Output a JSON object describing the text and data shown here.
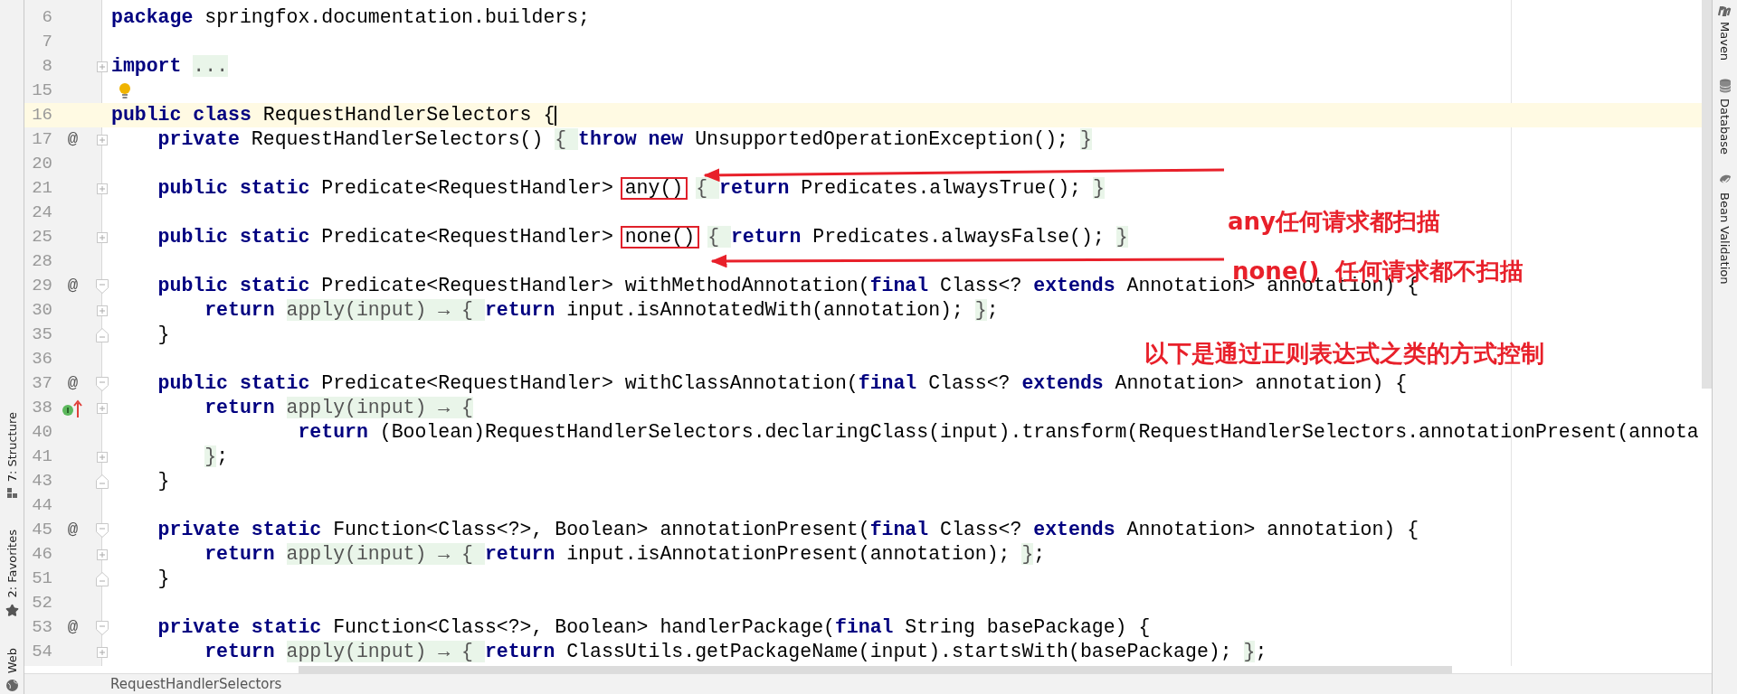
{
  "left_toolbar": [
    {
      "label": "7: Structure"
    },
    {
      "label": "2: Favorites"
    },
    {
      "label": "Web"
    }
  ],
  "right_toolbar": [
    {
      "label": "Maven"
    },
    {
      "label": "Database"
    },
    {
      "label": "Bean Validation"
    }
  ],
  "editor": {
    "lines": [
      {
        "number": "6",
        "segments": [
          {
            "kind": "kw",
            "text": "package"
          },
          {
            "kind": "txt",
            "text": " springfox.documentation.builders;"
          }
        ]
      },
      {
        "number": "7"
      },
      {
        "number": "8",
        "fold": {
          "kind": "expand"
        },
        "segments": [
          {
            "kind": "kw",
            "text": "import "
          },
          {
            "kind": "fold",
            "text": "..."
          }
        ]
      },
      {
        "number": "15",
        "bulb": true
      },
      {
        "number": "16",
        "current": true,
        "segments": [
          {
            "kind": "kw",
            "text": "public class"
          },
          {
            "kind": "txt",
            "text": " RequestHandlerSelectors {"
          }
        ]
      },
      {
        "number": "17",
        "marker": {
          "kind": "glyph",
          "text": "@"
        },
        "fold": {
          "kind": "expand"
        },
        "segments": [
          {
            "kind": "kw",
            "text": "    private"
          },
          {
            "kind": "txt",
            "text": " RequestHandlerSelectors() "
          },
          {
            "kind": "fold",
            "text": "{ "
          },
          {
            "kind": "kw",
            "text": "throw new"
          },
          {
            "kind": "txt",
            "text": " UnsupportedOperationException(); "
          },
          {
            "kind": "fold",
            "text": "}"
          }
        ]
      },
      {
        "number": "20"
      },
      {
        "number": "21",
        "fold": {
          "kind": "expand"
        },
        "segments": [
          {
            "kind": "kw",
            "text": "    public static"
          },
          {
            "kind": "txt",
            "text": " Predicate<RequestHandler> "
          },
          {
            "kind": "box",
            "text": "any()"
          },
          {
            "kind": "fold",
            "text": "{ "
          },
          {
            "kind": "kw",
            "text": "return"
          },
          {
            "kind": "txt",
            "text": " Predicates.alwaysTrue(); "
          },
          {
            "kind": "fold",
            "text": "}"
          }
        ]
      },
      {
        "number": "24"
      },
      {
        "number": "25",
        "fold": {
          "kind": "expand"
        },
        "segments": [
          {
            "kind": "kw",
            "text": "    public static"
          },
          {
            "kind": "txt",
            "text": " Predicate<RequestHandler> "
          },
          {
            "kind": "box",
            "text": "none()"
          },
          {
            "kind": "fold",
            "text": "{ "
          },
          {
            "kind": "kw",
            "text": "return"
          },
          {
            "kind": "txt",
            "text": " Predicates.alwaysFalse(); "
          },
          {
            "kind": "fold",
            "text": "}"
          }
        ]
      },
      {
        "number": "28"
      },
      {
        "number": "29",
        "marker": {
          "kind": "glyph",
          "text": "@"
        },
        "fold": {
          "kind": "start"
        },
        "segments": [
          {
            "kind": "kw",
            "text": "    public static"
          },
          {
            "kind": "txt",
            "text": " Predicate<RequestHandler> withMethodAnnotation("
          },
          {
            "kind": "kw",
            "text": "final"
          },
          {
            "kind": "txt",
            "text": " Class<? "
          },
          {
            "kind": "kw",
            "text": "extends"
          },
          {
            "kind": "txt",
            "text": " Annotation> annotation) {"
          }
        ]
      },
      {
        "number": "30",
        "fold": {
          "kind": "expand"
        },
        "segments": [
          {
            "kind": "kw",
            "text": "        return "
          },
          {
            "kind": "fold",
            "text": "apply(input) → { "
          },
          {
            "kind": "kw",
            "text": "return"
          },
          {
            "kind": "txt",
            "text": " input.isAnnotatedWith(annotation); "
          },
          {
            "kind": "fold",
            "text": "}"
          },
          {
            "kind": "txt",
            "text": ";"
          }
        ]
      },
      {
        "number": "35",
        "fold": {
          "kind": "end"
        },
        "segments": [
          {
            "kind": "txt",
            "text": "    }"
          }
        ]
      },
      {
        "number": "36"
      },
      {
        "number": "37",
        "marker": {
          "kind": "glyph",
          "text": "@"
        },
        "fold": {
          "kind": "start"
        },
        "segments": [
          {
            "kind": "kw",
            "text": "    public static"
          },
          {
            "kind": "txt",
            "text": " Predicate<RequestHandler> withClassAnnotation("
          },
          {
            "kind": "kw",
            "text": "final"
          },
          {
            "kind": "txt",
            "text": " Class<? "
          },
          {
            "kind": "kw",
            "text": "extends"
          },
          {
            "kind": "txt",
            "text": " Annotation> annotation) {"
          }
        ]
      },
      {
        "number": "38",
        "marker": {
          "kind": "implementation"
        },
        "fold": {
          "kind": "expand"
        },
        "segments": [
          {
            "kind": "kw",
            "text": "        return "
          },
          {
            "kind": "fold",
            "text": "apply(input) → {"
          }
        ]
      },
      {
        "number": "40",
        "segments": [
          {
            "kind": "kw",
            "text": "                return"
          },
          {
            "kind": "txt",
            "text": " (Boolean)RequestHandlerSelectors.declaringClass(input).transform(RequestHandlerSelectors.annotationPresent(annota"
          }
        ]
      },
      {
        "number": "41",
        "fold": {
          "kind": "expand"
        },
        "segments": [
          {
            "kind": "fold",
            "text": "        }"
          },
          {
            "kind": "txt",
            "text": ";"
          }
        ]
      },
      {
        "number": "43",
        "fold": {
          "kind": "end"
        },
        "segments": [
          {
            "kind": "txt",
            "text": "    }"
          }
        ]
      },
      {
        "number": "44"
      },
      {
        "number": "45",
        "marker": {
          "kind": "glyph",
          "text": "@"
        },
        "fold": {
          "kind": "start"
        },
        "segments": [
          {
            "kind": "kw",
            "text": "    private static"
          },
          {
            "kind": "txt",
            "text": " Function<Class<?>, Boolean> annotationPresent("
          },
          {
            "kind": "kw",
            "text": "final"
          },
          {
            "kind": "txt",
            "text": " Class<? "
          },
          {
            "kind": "kw",
            "text": "extends"
          },
          {
            "kind": "txt",
            "text": " Annotation> annotation) {"
          }
        ]
      },
      {
        "number": "46",
        "fold": {
          "kind": "expand"
        },
        "segments": [
          {
            "kind": "kw",
            "text": "        return "
          },
          {
            "kind": "fold",
            "text": "apply(input) → { "
          },
          {
            "kind": "kw",
            "text": "return"
          },
          {
            "kind": "txt",
            "text": " input.isAnnotationPresent(annotation); "
          },
          {
            "kind": "fold",
            "text": "}"
          },
          {
            "kind": "txt",
            "text": ";"
          }
        ]
      },
      {
        "number": "51",
        "fold": {
          "kind": "end"
        },
        "segments": [
          {
            "kind": "txt",
            "text": "    }"
          }
        ]
      },
      {
        "number": "52"
      },
      {
        "number": "53",
        "marker": {
          "kind": "glyph",
          "text": "@"
        },
        "fold": {
          "kind": "start"
        },
        "segments": [
          {
            "kind": "kw",
            "text": "    private static"
          },
          {
            "kind": "txt",
            "text": " Function<Class<?>, Boolean> handlerPackage("
          },
          {
            "kind": "kw",
            "text": "final"
          },
          {
            "kind": "txt",
            "text": " String basePackage) {"
          }
        ]
      },
      {
        "number": "54",
        "fold": {
          "kind": "expand"
        },
        "segments": [
          {
            "kind": "kw",
            "text": "        return "
          },
          {
            "kind": "fold",
            "text": "apply(input) → { "
          },
          {
            "kind": "kw",
            "text": "return"
          },
          {
            "kind": "txt",
            "text": " ClassUtils.getPackageName(input).startsWith(basePackage); "
          },
          {
            "kind": "fold",
            "text": "}"
          },
          {
            "kind": "txt",
            "text": ";"
          }
        ]
      }
    ]
  },
  "annotations": [
    {
      "text": "any任何请求都扫描"
    },
    {
      "text": "none()  任何请求都不扫描"
    },
    {
      "text": "以下是通过正则表达式之类的方式控制"
    }
  ],
  "breadcrumb": "RequestHandlerSelectors"
}
